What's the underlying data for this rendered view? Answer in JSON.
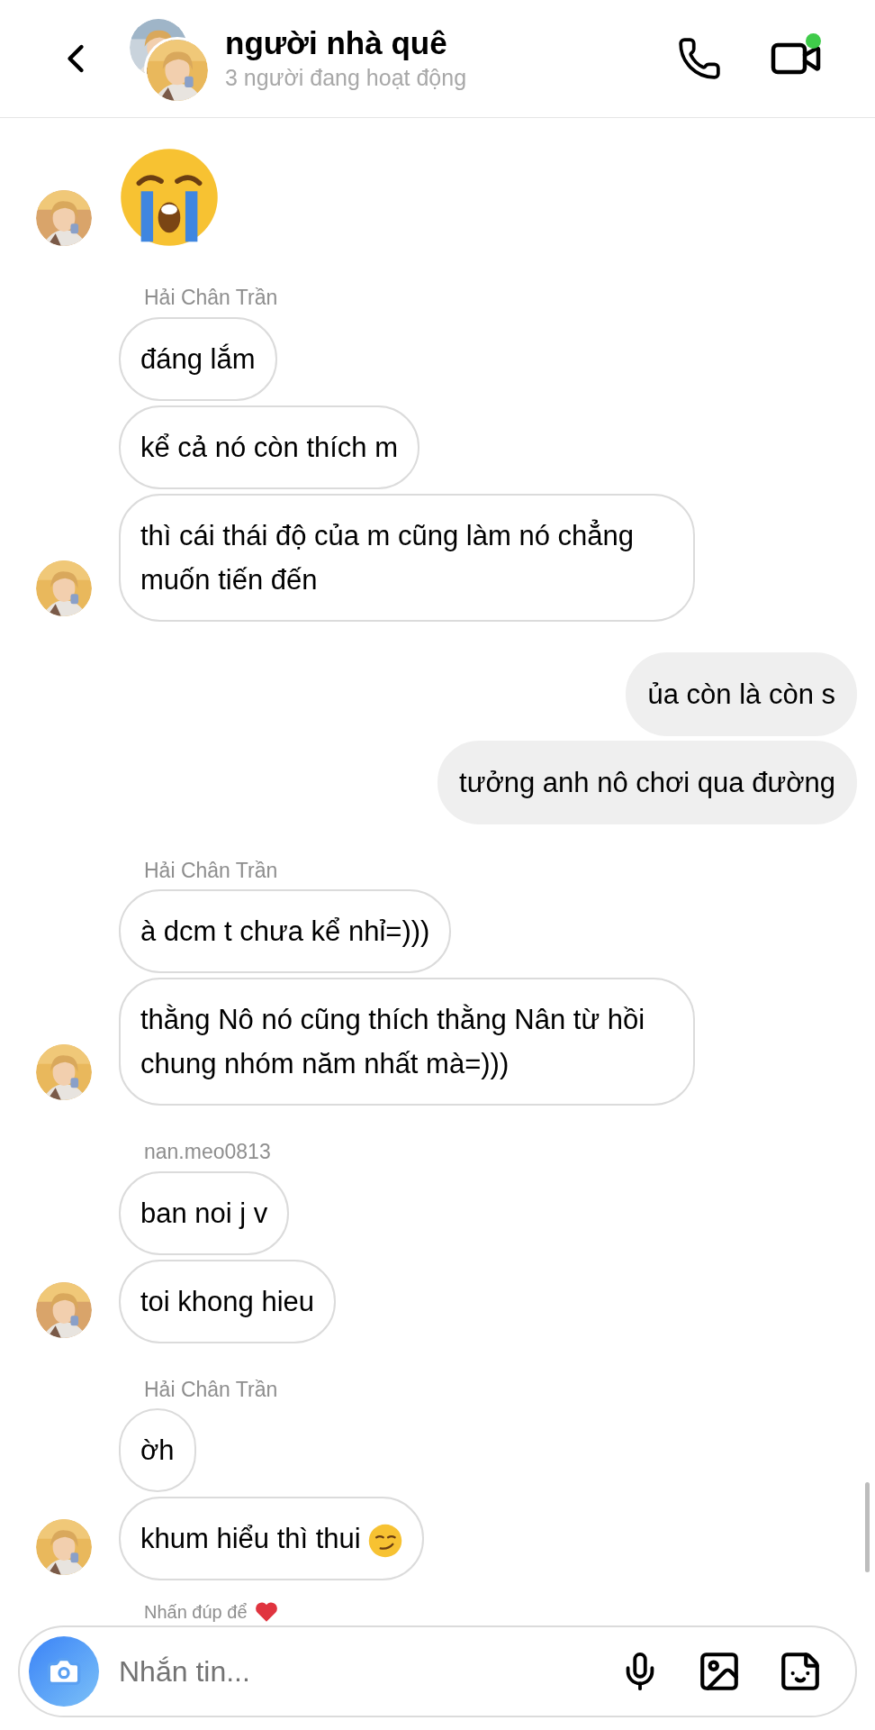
{
  "header": {
    "title": "người nhà quê",
    "subtitle": "3 người đang hoạt động",
    "video_active": true
  },
  "groups": [
    {
      "kind": "incoming",
      "messages": [
        {
          "kind": "emoji"
        }
      ]
    },
    {
      "kind": "incoming",
      "sender": "Hải Chân Trần",
      "messages": [
        {
          "kind": "text",
          "text": "đáng lắm"
        },
        {
          "kind": "text",
          "text": "kể cả nó còn thích m"
        },
        {
          "kind": "text",
          "text": "thì cái thái độ của m cũng làm nó chẳng muốn tiến đến"
        }
      ]
    },
    {
      "kind": "outgoing",
      "messages": [
        {
          "kind": "text",
          "text": "ủa còn là còn s"
        },
        {
          "kind": "text",
          "text": "tưởng anh nô chơi qua đường"
        }
      ]
    },
    {
      "kind": "incoming",
      "sender": "Hải Chân Trần",
      "messages": [
        {
          "kind": "text",
          "text": "à dcm t chưa kể nhỉ=)))"
        },
        {
          "kind": "text",
          "text": "thằng Nô nó cũng thích thằng Nân từ hồi chung nhóm năm nhất mà=)))"
        }
      ]
    },
    {
      "kind": "incoming",
      "sender": "nan.meo0813",
      "messages": [
        {
          "kind": "text",
          "text": "ban noi j v"
        },
        {
          "kind": "text",
          "text": "toi khong hieu"
        }
      ]
    },
    {
      "kind": "incoming",
      "sender": "Hải Chân Trần",
      "messages": [
        {
          "kind": "text",
          "text": "ờh"
        },
        {
          "kind": "text",
          "text": "khum hiểu thì thui",
          "trailing_emoji": true
        }
      ]
    }
  ],
  "hint": {
    "text": "Nhấn đúp để",
    "heart": true
  },
  "composer": {
    "placeholder": "Nhắn tin..."
  }
}
